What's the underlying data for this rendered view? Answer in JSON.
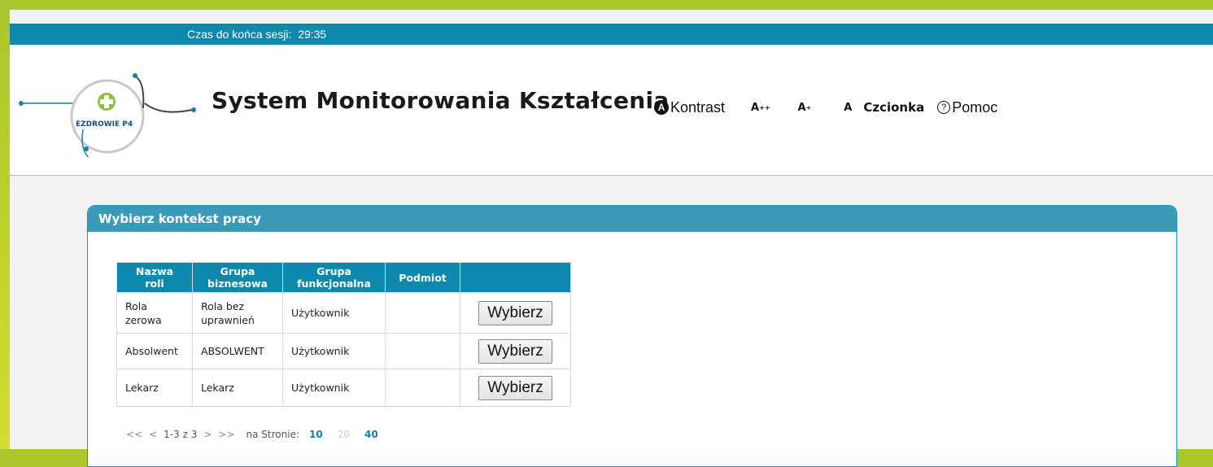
{
  "session": {
    "label": "Czas do końca sesji:",
    "time": "29:35"
  },
  "header": {
    "logo_text": "EZDROWIE P4",
    "title": "System Monitorowania Kształcenia",
    "toolbar": {
      "kontrast": "Kontrast",
      "font_larger": "A",
      "font_larger_sup": "++",
      "font_large": "A",
      "font_large_sup": "+",
      "font_normal": "A",
      "czcionka": "Czcionka",
      "pomoc": "Pomoc"
    }
  },
  "panel": {
    "title": "Wybierz kontekst pracy",
    "columns": [
      "Nazwa roli",
      "Grupa biznesowa",
      "Grupa funkcjonalna",
      "Podmiot",
      ""
    ],
    "rows": [
      {
        "rola": "Rola zerowa",
        "grupa_biz": "Rola bez uprawnień",
        "grupa_funk": "Użytkownik",
        "podmiot": "",
        "button": "Wybierz"
      },
      {
        "rola": "Absolwent",
        "grupa_biz": "ABSOLWENT",
        "grupa_funk": "Użytkownik",
        "podmiot": "",
        "button": "Wybierz"
      },
      {
        "rola": "Lekarz",
        "grupa_biz": "Lekarz",
        "grupa_funk": "Użytkownik",
        "podmiot": "",
        "button": "Wybierz"
      }
    ],
    "pager": {
      "first": "<<",
      "prev": "<",
      "range": "1-3 z 3",
      "next": ">",
      "last": ">>",
      "per_page_label": "na Stronie:",
      "per_page_options": [
        "10",
        "20",
        "40"
      ]
    }
  },
  "colors": {
    "accent": "#0f88ad",
    "panel_header": "#3b9ab8",
    "frame": "#a9c62a"
  }
}
